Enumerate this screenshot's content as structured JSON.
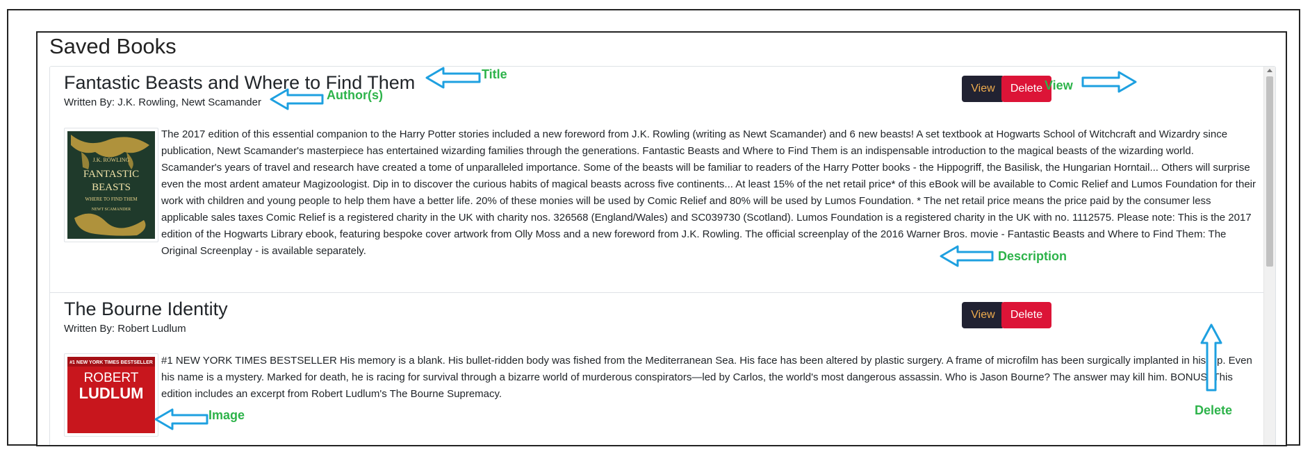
{
  "header": {
    "title": "Saved Books"
  },
  "books": [
    {
      "title": "Fantastic Beasts and Where to Find Them",
      "authors": "Written By: J.K. Rowling, Newt Scamander",
      "description": "The 2017 edition of this essential companion to the Harry Potter stories included a new foreword from J.K. Rowling (writing as Newt Scamander) and 6 new beasts! A set textbook at Hogwarts School of Witchcraft and Wizardry since publication, Newt Scamander's masterpiece has entertained wizarding families through the generations. Fantastic Beasts and Where to Find Them is an indispensable introduction to the magical beasts of the wizarding world. Scamander's years of travel and research have created a tome of unparalleled importance. Some of the beasts will be familiar to readers of the Harry Potter books - the Hippogriff, the Basilisk, the Hungarian Horntail... Others will surprise even the most ardent amateur Magizoologist. Dip in to discover the curious habits of magical beasts across five continents... At least 15% of the net retail price* of this eBook will be available to Comic Relief and Lumos Foundation for their work with children and young people to help them have a better life. 20% of these monies will be used by Comic Relief and 80% will be used by Lumos Foundation. * The net retail price means the price paid by the consumer less applicable sales taxes Comic Relief is a registered charity in the UK with charity nos. 326568 (England/Wales) and SC039730 (Scotland). Lumos Foundation is a registered charity in the UK with no. 1112575. Please note: This is the 2017 edition of the Hogwarts Library ebook, featuring bespoke cover artwork from Olly Moss and a new foreword from J.K. Rowling. The official screenplay of the 2016 Warner Bros. movie - Fantastic Beasts and Where to Find Them: The Original Screenplay - is available separately.",
      "cover": {
        "author_line": "J.K. ROWLING",
        "title_line1": "FANTASTIC",
        "title_line2": "BEASTS",
        "subtitle": "WHERE TO FIND THEM",
        "byline": "NEWT SCAMANDER",
        "colors": {
          "background": "#1f3a2b",
          "accent": "#c9a23f"
        }
      },
      "view_label": "View",
      "delete_label": "Delete"
    },
    {
      "title": "The Bourne Identity",
      "authors": "Written By: Robert Ludlum",
      "description": "#1 NEW YORK TIMES BESTSELLER His memory is a blank. His bullet-ridden body was fished from the Mediterranean Sea. His face has been altered by plastic surgery. A frame of microfilm has been surgically implanted in his hip. Even his name is a mystery. Marked for death, he is racing for survival through a bizarre world of murderous conspirators—led by Carlos, the world's most dangerous assassin. Who is Jason Bourne? The answer may kill him. BONUS: This edition includes an excerpt from Robert Ludlum's The Bourne Supremacy.",
      "cover": {
        "banner": "#1 NEW YORK TIMES BESTSELLER",
        "author_first": "ROBERT",
        "author_last": "LUDLUM",
        "colors": {
          "background": "#c8161d",
          "text": "#ffffff"
        }
      },
      "view_label": "View",
      "delete_label": "Delete"
    }
  ],
  "annotations": {
    "title": "Title",
    "authors": "Author(s)",
    "view": "View",
    "description": "Description",
    "image": "Image",
    "delete": "Delete"
  },
  "colors": {
    "annotation_text": "#2db34a",
    "annotation_arrow": "#1ea0e0",
    "view_button_bg": "#212232",
    "view_button_text": "#f0ad4e",
    "delete_button_bg": "#dc1437"
  }
}
